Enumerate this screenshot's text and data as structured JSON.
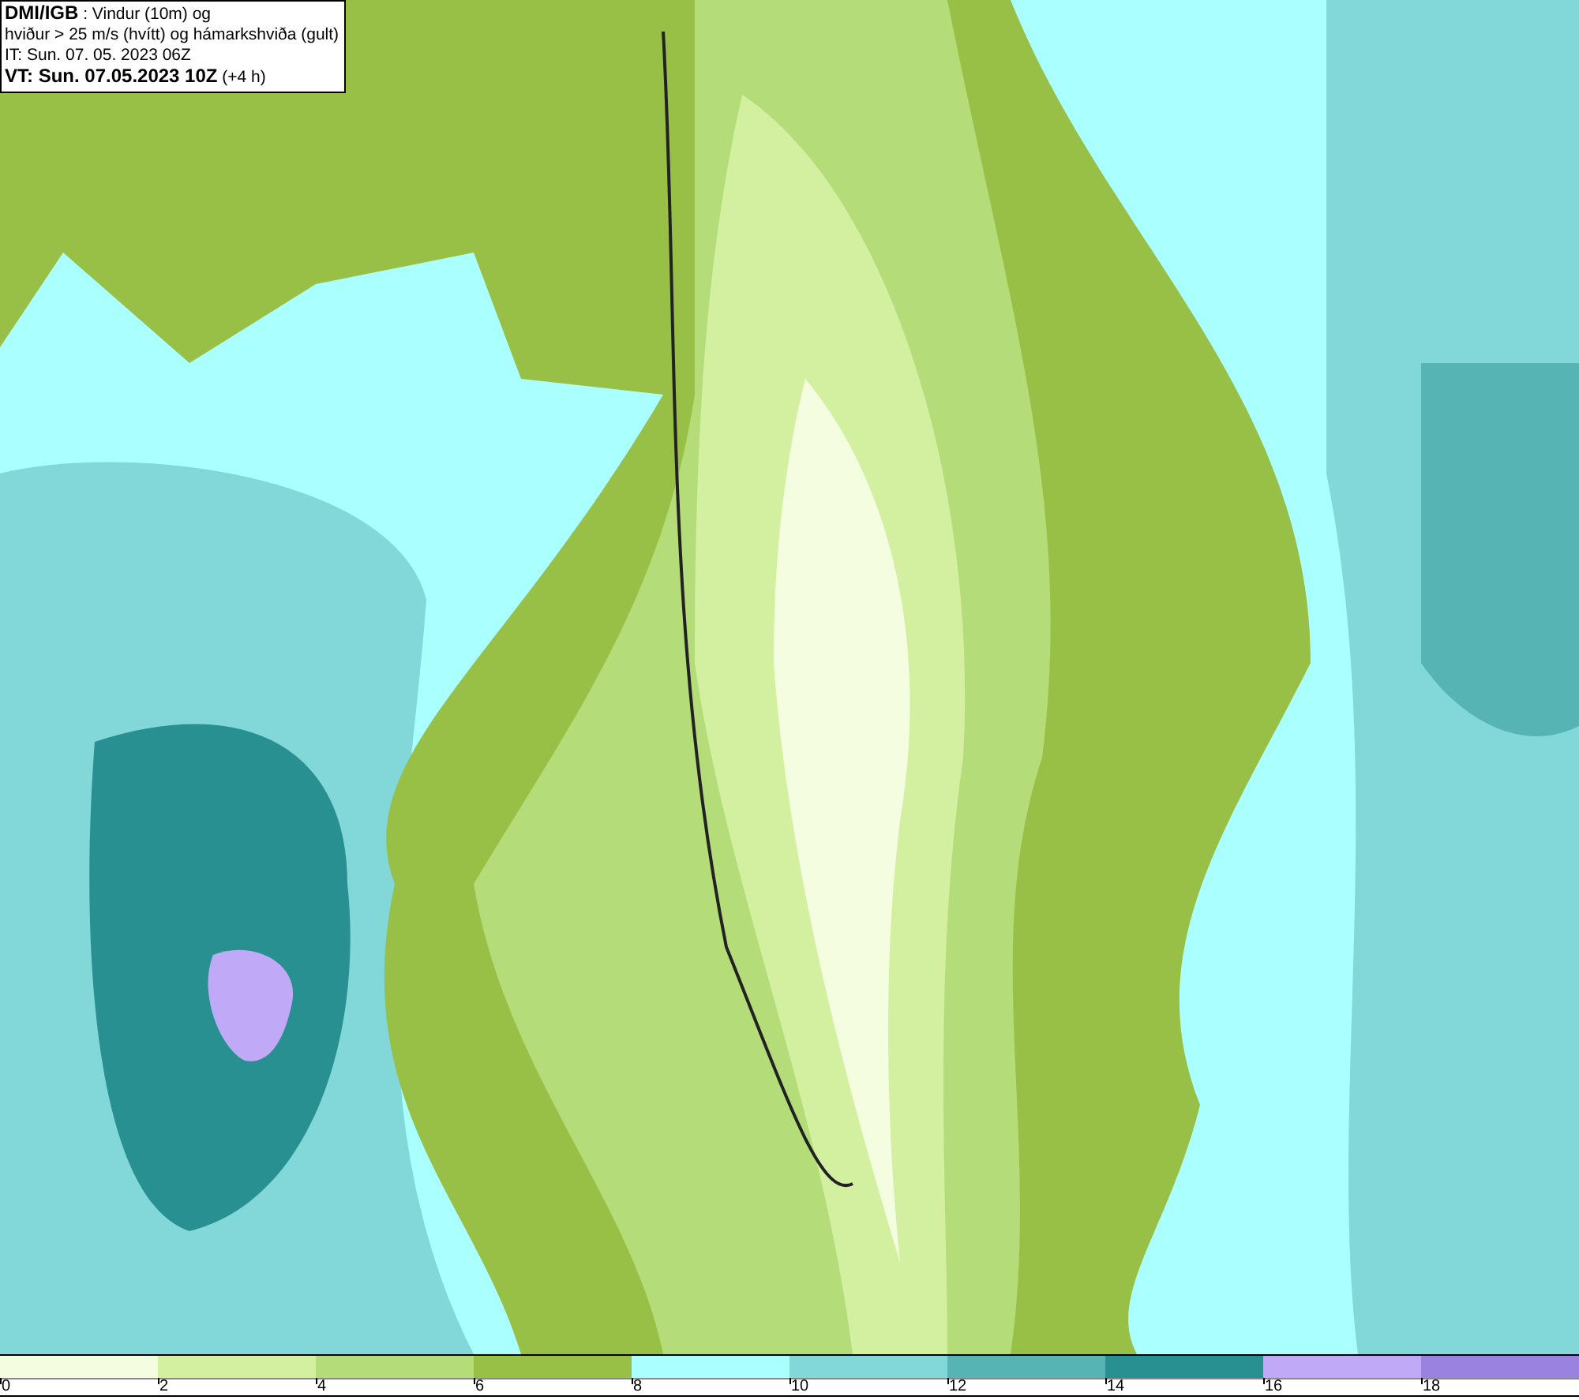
{
  "title_box": {
    "lines": [
      "**DMI/IGB** : Vindur (10m) og",
      "hviður > 25 m/s (hvítt) og hámarkshviða (gult)",
      "IT: Sun. 07. 05. 2023 06Z",
      "**VT: Sun. 07.05.2023 10Z** (+4 h)"
    ]
  },
  "legend": [
    {
      "label": "0",
      "color": "#f5fde0"
    },
    {
      "label": "2",
      "color": "#d3f0a0"
    },
    {
      "label": "4",
      "color": "#b4dc78"
    },
    {
      "label": "6",
      "color": "#98c046"
    },
    {
      "label": "8",
      "color": "#aaffff"
    },
    {
      "label": "10",
      "color": "#82d8d8"
    },
    {
      "label": "12",
      "color": "#56b4b4"
    },
    {
      "label": "14",
      "color": "#289090"
    },
    {
      "label": "16",
      "color": "#c0aaf8"
    },
    {
      "label": "18",
      "color": "#9a82e0"
    }
  ]
}
